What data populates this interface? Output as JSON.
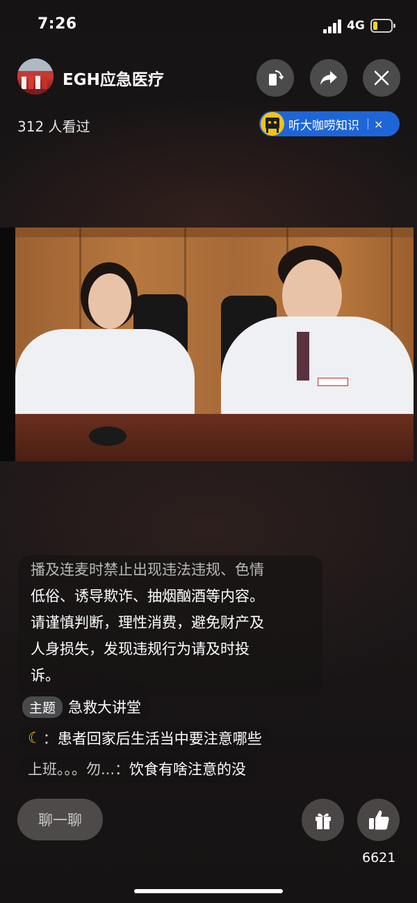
{
  "status_bar": {
    "time": "7:26",
    "network": "4G",
    "battery_level": 0.2,
    "battery_color": "#f6d12b"
  },
  "header": {
    "channel_name": "EGH应急医疗",
    "viewers": "312 人看过",
    "buttons": {
      "rotate_icon": "rotate-screen-icon",
      "share_icon": "share-arrow-icon",
      "close_icon": "close-icon"
    },
    "audio_pill": {
      "label": "听大咖唠知识",
      "close": "×",
      "color": "#1e66d8"
    }
  },
  "chat": {
    "notice_lines": [
      "播及连麦时禁止出现违法违规、色情",
      "低俗、诱导欺诈、抽烟酗酒等内容。",
      "请谨慎判断，理性消费，避免财产及",
      "人身损失，发现违规行为请及时投",
      "诉。"
    ],
    "topic_tag": "主题",
    "topic_text": "急救大讲堂",
    "messages": [
      {
        "user": "🌙",
        "separator": "：",
        "text": "患者回家后生活当中要注意哪些"
      },
      {
        "user": "上班。。。勿...",
        "separator": "：",
        "text": "饮食有啥注意的没"
      }
    ]
  },
  "bottom_bar": {
    "chat_placeholder": "聊一聊",
    "gift_icon": "gift-icon",
    "like_icon": "thumbs-up-icon",
    "like_count": "6621"
  }
}
